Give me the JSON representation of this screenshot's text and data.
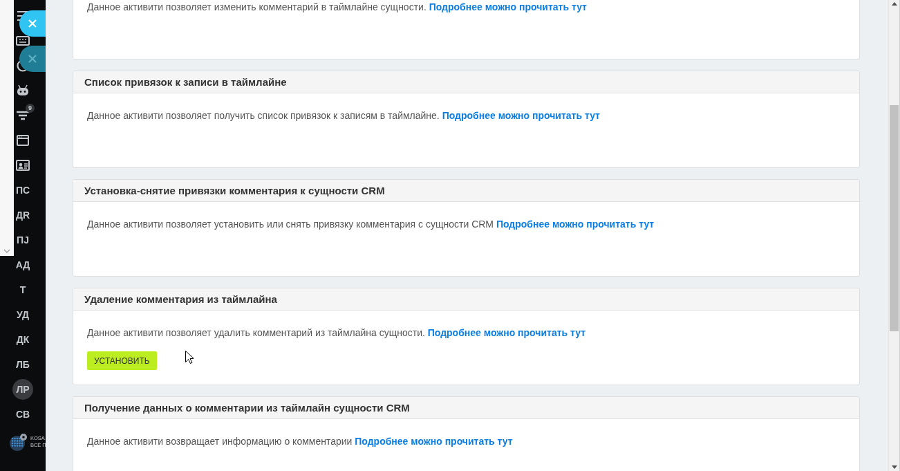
{
  "sidebar": {
    "filter_badge": "9",
    "items": [
      {
        "label": "ПС",
        "selected": false
      },
      {
        "label": "ДR",
        "selected": false
      },
      {
        "label": "ПJ",
        "selected": false
      },
      {
        "label": "АД",
        "selected": false
      },
      {
        "label": "Т",
        "selected": false
      },
      {
        "label": "УД",
        "selected": false
      },
      {
        "label": "ДК",
        "selected": false
      },
      {
        "label": "ЛБ",
        "selected": false
      },
      {
        "label": "ЛР",
        "selected": true
      },
      {
        "label": "СВ",
        "selected": false
      }
    ],
    "logo": {
      "lines": [
        "KOSA",
        "ВСЁ П"
      ]
    }
  },
  "cards": [
    {
      "text": "Данное активити позволяет изменить комментарий в таймлайне сущности.",
      "link": "Подробнее можно прочитать тут"
    },
    {
      "title": "Список привязок к записи в таймлайне",
      "text": "Данное активити позволяет получить список привязок к записям в таймлайне.",
      "link": "Подробнее можно прочитать тут"
    },
    {
      "title": "Установка-снятие привязки комментария к сущности CRM",
      "text": "Данное активити позволяет установить или снять привязку комментария с сущности CRM",
      "link": "Подробнее можно прочитать тут"
    },
    {
      "title": "Удаление комментария из таймлайна",
      "text": "Данное активити позволяет удалить комментарий из таймлайна сущности.",
      "link": "Подробнее можно прочитать тут",
      "button": "УСТАНОВИТЬ"
    },
    {
      "title": "Получение данных о комментарии из таймлайн сущности CRM",
      "text": "Данное активити возвращает информацию о комментарии",
      "link": "Подробнее можно прочитать тут"
    }
  ]
}
